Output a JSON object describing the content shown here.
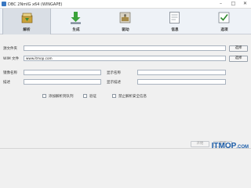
{
  "window": {
    "title": "DBC 2NmIG x64 (WINGAPE)",
    "minimize": "–",
    "maximize": "□",
    "close": "✕"
  },
  "ribbon": {
    "tabs": [
      {
        "label": "解析",
        "icon": "extract-icon",
        "active": true
      },
      {
        "label": "生成",
        "icon": "download-icon",
        "active": false
      },
      {
        "label": "驱动",
        "icon": "puzzle-icon",
        "active": false
      },
      {
        "label": "信息",
        "icon": "info-icon",
        "active": false
      },
      {
        "label": "选项",
        "icon": "check-icon",
        "active": false
      }
    ]
  },
  "form": {
    "source_label": "源文件夹",
    "source_value": "",
    "browse1": "选择",
    "wim_label": "WIM 文件",
    "wim_value": "www.itmop.com",
    "browse2": "选择",
    "image_name_label": "镜像名称",
    "image_name_value": "",
    "display_name_label": "显示名称",
    "display_name_value": "",
    "desc_label": "描述",
    "desc_value": "",
    "display_desc_label": "显示描述",
    "display_desc_value": "",
    "check1_label": "添加解析到队列",
    "check2_label": "验证",
    "check3_label": "禁止解析安全信息",
    "start_button": "开始",
    "cancel_button": "取消"
  },
  "watermark": {
    "main": "ITMOP",
    "suffix": ".COM"
  },
  "colors": {
    "accent": "#3a78c2",
    "ribbon_bg": "#eef2f7",
    "watermark": "#1e5faa"
  }
}
